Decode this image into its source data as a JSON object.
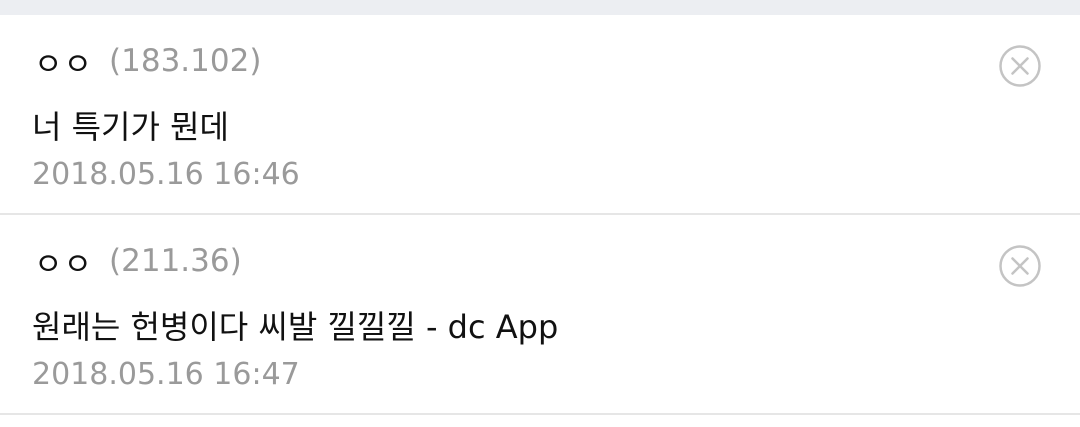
{
  "comments": [
    {
      "nickname": "ㅇㅇ",
      "ip": "(183.102)",
      "text": "너 특기가 뭔데",
      "date": "2018.05.16 16:46",
      "delete_icon": "close-circle-icon"
    },
    {
      "nickname": "ㅇㅇ",
      "ip": "(211.36)",
      "text": "원래는 헌병이다 씨발 낄낄낄 - dc App",
      "date": "2018.05.16 16:47",
      "delete_icon": "close-circle-icon"
    }
  ],
  "colors": {
    "text": "#111111",
    "muted": "#9a9a9a",
    "divider": "#e6e6e6",
    "top_band": "#eceef2",
    "icon": "#c4c4c4"
  }
}
